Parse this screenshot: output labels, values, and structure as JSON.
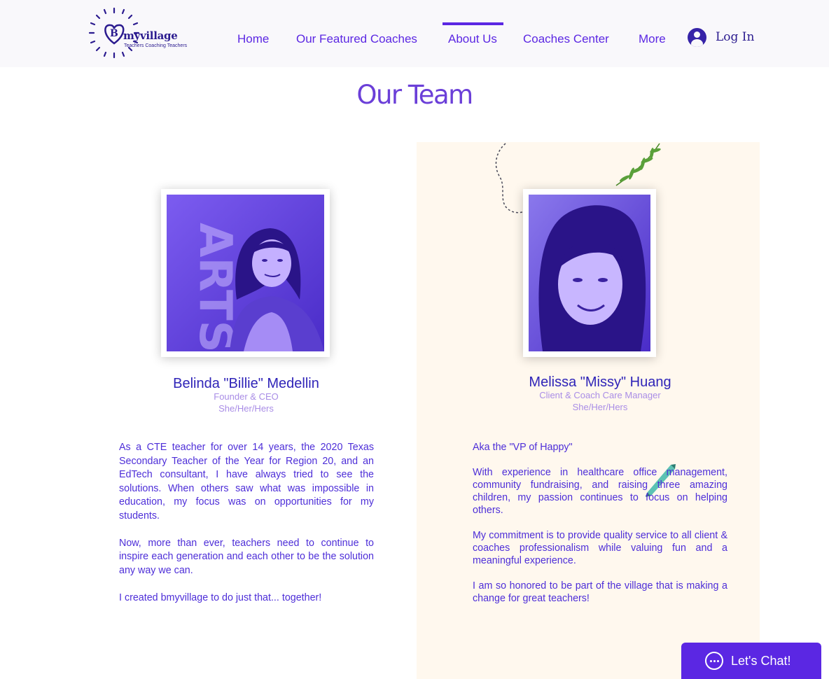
{
  "logo": {
    "brand": "myvillage",
    "tagline": "Teachers Coaching Teachers",
    "letter": "B"
  },
  "nav": {
    "items": [
      {
        "label": "Home"
      },
      {
        "label": "Our Featured Coaches"
      },
      {
        "label": "About Us",
        "active": true
      },
      {
        "label": "Coaches Center"
      },
      {
        "label": "More"
      }
    ],
    "login_label": "Log In"
  },
  "page": {
    "title": "Our Team"
  },
  "team": [
    {
      "name": "Belinda \"Billie\" Medellin",
      "title": "Founder & CEO",
      "pronouns": "She/Her/Hers",
      "bio": [
        "As a CTE teacher for over 14 years, the 2020 Texas Secondary Teacher of the Year for Region 20, and an EdTech consultant, I have always tried to see the solutions.  When others saw what was impossible in education, my focus was on opportunities for my students.",
        "Now, more than ever, teachers need to continue to inspire each generation and each other to be the solution any way we can.",
        "I created bmyvillage to do just that... together!"
      ]
    },
    {
      "name": "Melissa \"Missy\" Huang",
      "title": "Client & Coach Care Manager",
      "pronouns": "She/Her/Hers",
      "bio": [
        "Aka the \"VP of Happy\"",
        "With experience in healthcare office management, community fundraising, and raising three amazing children, my passion continues to focus on helping others.",
        "My commitment is to provide quality service to all client & coaches professionalism while valuing fun and a meaningful experience.",
        "I am so honored to be part of the village that is making a change for great teachers!"
      ]
    }
  ],
  "chat": {
    "label": "Let's Chat!"
  },
  "colors": {
    "accent": "#5b27e3",
    "navy": "#2b1b8f",
    "panel": "#fff8ee"
  }
}
